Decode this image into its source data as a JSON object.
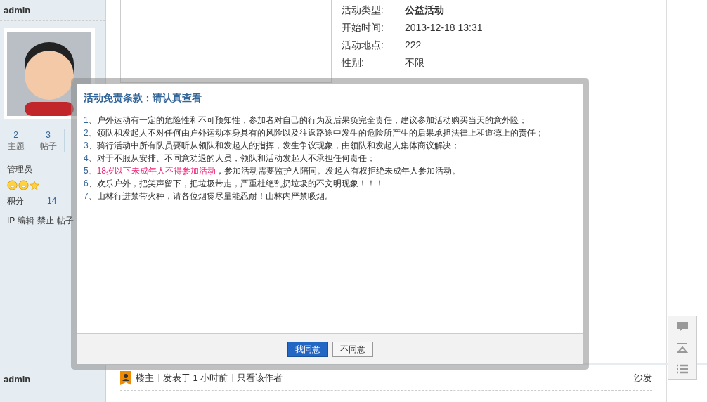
{
  "post": {
    "username": "admin",
    "stats": [
      {
        "value": "2",
        "label": "主题"
      },
      {
        "value": "3",
        "label": "帖子"
      }
    ],
    "group": "管理员",
    "points_label": "积分",
    "points_value": "14",
    "actions": [
      "IP",
      "编辑",
      "禁止",
      "帖子"
    ],
    "activity_info": [
      {
        "label": "活动类型:",
        "value": "公益活动",
        "bold": true
      },
      {
        "label": "开始时间:",
        "value": "2013-12-18 13:31",
        "bold": false
      },
      {
        "label": "活动地点:",
        "value": "222",
        "bold": false
      },
      {
        "label": "性别:",
        "value": "不限",
        "bold": false
      }
    ]
  },
  "dialog": {
    "title": "活动免责条款：请认真查看",
    "terms": [
      {
        "number": "1",
        "text": "、户外运动有一定的危险性和不可预知性，参加者对自己的行为及后果负完全责任，建议参加活动购买当天的意外险；"
      },
      {
        "number": "2",
        "text": "、领队和发起人不对任何由户外运动本身具有的风险以及往返路途中发生的危险所产生的后果承担法律上和道德上的责任；"
      },
      {
        "number": "3",
        "text": "、骑行活动中所有队员要听从领队和发起人的指挥，发生争议现象，由领队和发起人集体商议解决；"
      },
      {
        "number": "4",
        "text": "、对于不服从安排、不同意劝退的人员，领队和活动发起人不承担任何责任；"
      },
      {
        "number": "5、",
        "highlight": "18岁以下未成年人不得参加活动",
        "text": "，参加活动需要监护人陪同。发起人有权拒绝未成年人参加活动。"
      },
      {
        "number": "6",
        "text": "、欢乐户外，把笑声留下，把垃圾带走，严重杜绝乱扔垃圾的不文明现象！！！"
      },
      {
        "number": "7",
        "text": "、山林行进禁带火种，请各位烟煲尽量能忍耐！山林内严禁吸烟。"
      }
    ],
    "buttons": [
      {
        "label": "我同意",
        "primary": true
      },
      {
        "label": "不同意",
        "primary": false
      }
    ]
  },
  "next_post": {
    "username": "admin",
    "author_badge": "楼主",
    "posted": "发表于 1 小时前",
    "filter_link": "只看该作者",
    "floor": "沙发"
  }
}
